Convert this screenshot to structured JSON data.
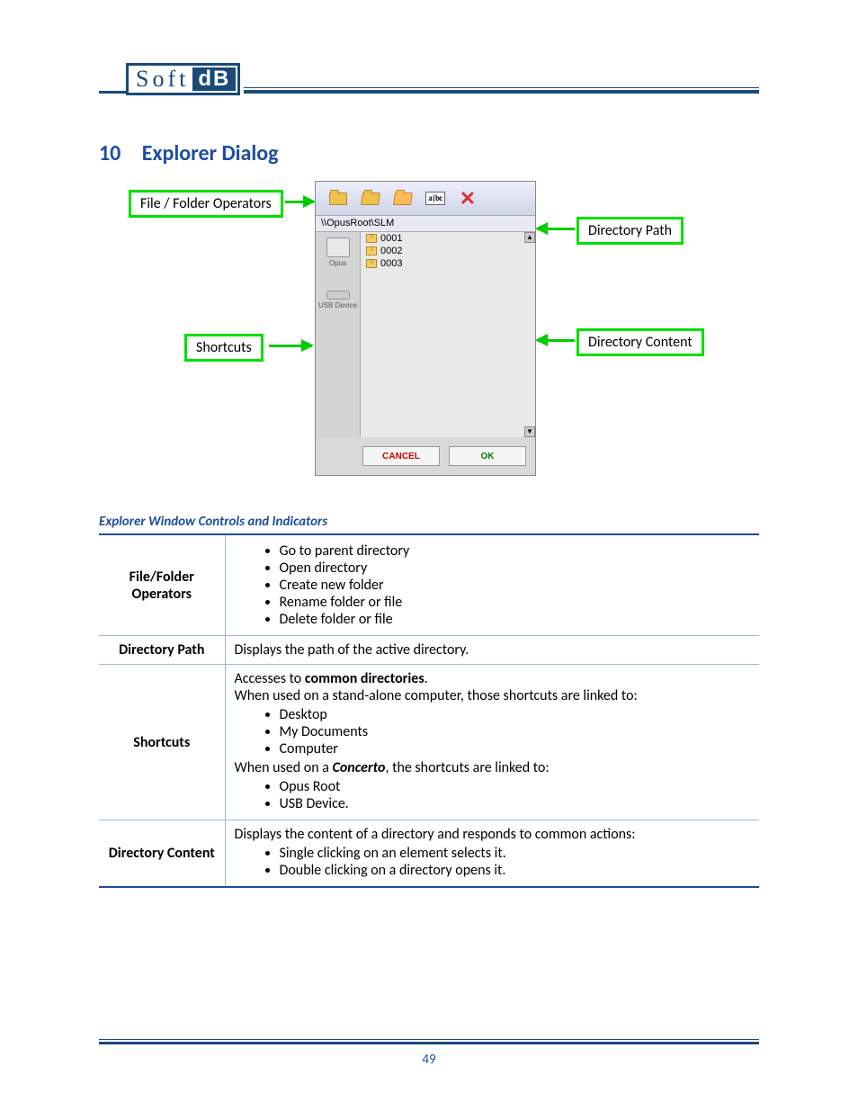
{
  "logo": {
    "soft": "Soft",
    "db": "dB"
  },
  "heading": {
    "num": "10",
    "title": "Explorer Dialog"
  },
  "callouts": {
    "operators": "File / Folder Operators",
    "shortcuts": "Shortcuts",
    "path": "Directory Path",
    "content": "Directory Content"
  },
  "toolbar": {
    "abc_label": "a|bc",
    "x_glyph": "✕"
  },
  "pathbar": "\\\\OpusRoot\\SLM",
  "sidebar": {
    "opus": "Opus",
    "usb": "USB Device"
  },
  "files": [
    "0001",
    "0002",
    "0003"
  ],
  "buttons": {
    "cancel": "CANCEL",
    "ok": "OK"
  },
  "table_heading": "Explorer Window Controls and Indicators",
  "rows": {
    "r1": {
      "label": "File/Folder Operators",
      "items": [
        "Go to parent directory",
        "Open directory",
        "Create new folder",
        "Rename folder or file",
        "Delete folder or file"
      ]
    },
    "r2": {
      "label": "Directory Path",
      "text": "Displays the path of the active directory."
    },
    "r3": {
      "label": "Shortcuts",
      "intro_a": "Accesses to ",
      "intro_b": "common directories",
      "intro_c": ".",
      "line2": "When used on a stand-alone computer, those shortcuts are linked to:",
      "list1": [
        "Desktop",
        "My Documents",
        "Computer"
      ],
      "line3a": "When used on a ",
      "line3b": "Concerto",
      "line3c": ", the shortcuts are linked to:",
      "list2": [
        "Opus Root",
        "USB Device."
      ]
    },
    "r4": {
      "label": "Directory Content",
      "text": "Displays the content of a directory and responds to common actions:",
      "items": [
        "Single clicking on an element selects it.",
        "Double clicking on a directory opens it."
      ]
    }
  },
  "page_number": "49"
}
